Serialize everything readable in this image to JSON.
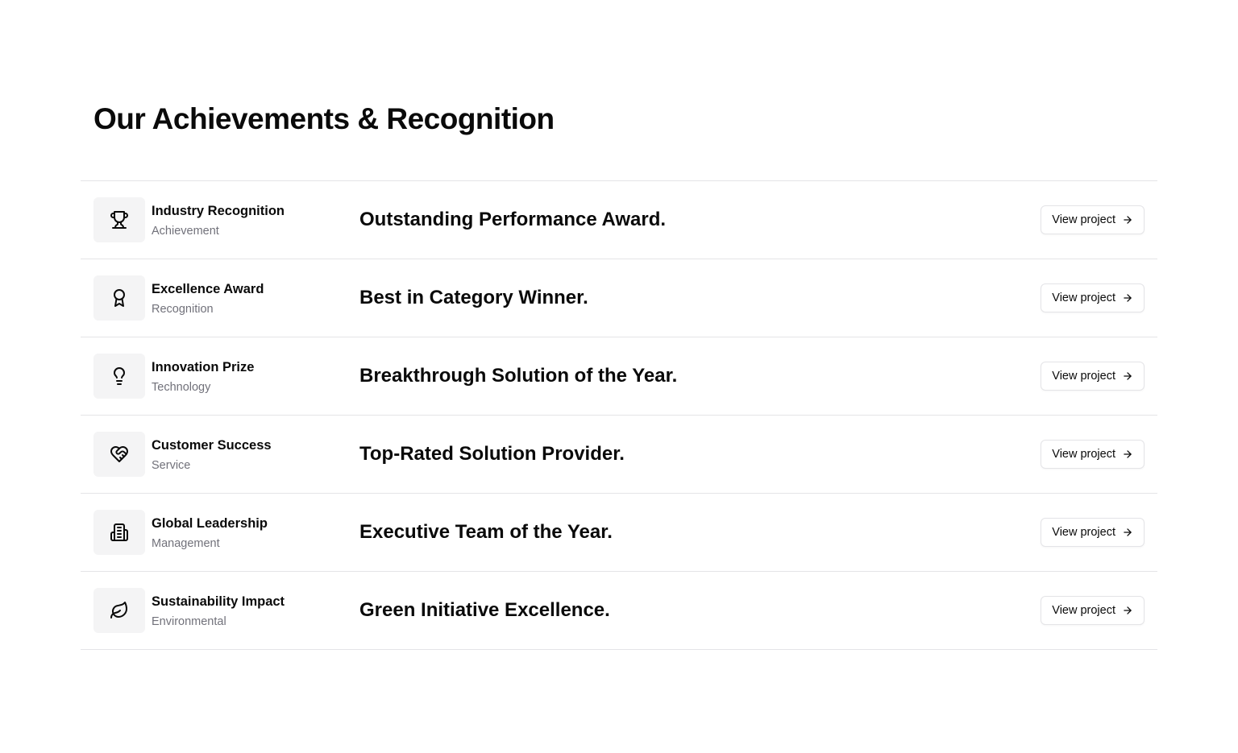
{
  "page": {
    "heading": "Our Achievements & Recognition"
  },
  "achievements": [
    {
      "title": "Industry Recognition",
      "category": "Achievement",
      "headline": "Outstanding Performance Award.",
      "button_label": "View project",
      "icon": "trophy-icon"
    },
    {
      "title": "Excellence Award",
      "category": "Recognition",
      "headline": "Best in Category Winner.",
      "button_label": "View project",
      "icon": "award-icon"
    },
    {
      "title": "Innovation Prize",
      "category": "Technology",
      "headline": "Breakthrough Solution of the Year.",
      "button_label": "View project",
      "icon": "lightbulb-icon"
    },
    {
      "title": "Customer Success",
      "category": "Service",
      "headline": "Top-Rated Solution Provider.",
      "button_label": "View project",
      "icon": "heart-handshake-icon"
    },
    {
      "title": "Global Leadership",
      "category": "Management",
      "headline": "Executive Team of the Year.",
      "button_label": "View project",
      "icon": "building-icon"
    },
    {
      "title": "Sustainability Impact",
      "category": "Environmental",
      "headline": "Green Initiative Excellence.",
      "button_label": "View project",
      "icon": "leaf-icon"
    }
  ],
  "colors": {
    "text": "#0a0a0a",
    "muted_text": "#71717a",
    "border": "#e4e4e7",
    "icon_background": "#f4f4f5"
  }
}
